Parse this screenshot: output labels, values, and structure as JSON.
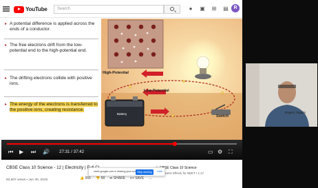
{
  "topbar": {
    "logo_text": "YouTube",
    "search_placeholder": "Search",
    "avatar_letter": "R"
  },
  "slide": {
    "bullets": [
      "A potential difference is applied across the ends of a conductor.",
      "The free electrons drift from the low-potential end to the high-potential end.",
      "The drifting electrons collide with positive ions.",
      "The energy of the electrons is transferred to the positive ions, creating resistance."
    ],
    "highlighted_bullet_index": 3,
    "highlight_color": "#f4d24a"
  },
  "animation": {
    "high_potential_label": "High-Potential",
    "low_potential_label": "Low-Potential",
    "switch_label": "Switch",
    "battery_label": "Battery"
  },
  "player": {
    "time": "27:31 / 37:42",
    "progress_fraction": 0.73,
    "progress_color": "#ff0000"
  },
  "webcam": {
    "name": "Rajesh Tripathi"
  },
  "video": {
    "title": "CBSE Class 10 Science - 12 | Electricity | Full Cl",
    "meta": "92,907 views • Jun 30, 2019",
    "actions": [
      "955",
      "58",
      "SHARE",
      "SAVE",
      "..."
    ]
  },
  "screen_share_bar": {
    "text": "meet.google.com is sharing your screen.",
    "stop_label": "Stop sharing",
    "hide_label": "Hide"
  },
  "suggestion": {
    "title": "CBSE Class 10 Science",
    "subtitle": "Magnetic Effects for NEET • 1:17"
  }
}
